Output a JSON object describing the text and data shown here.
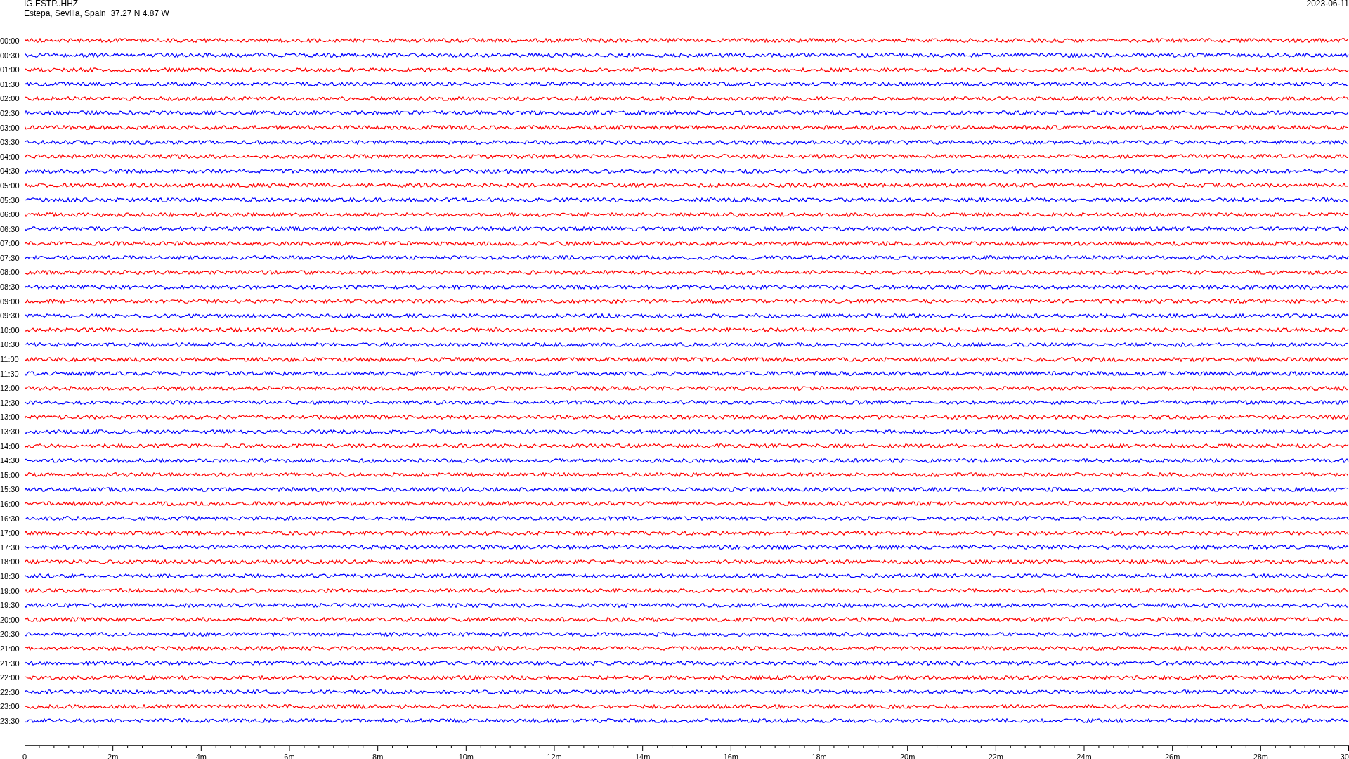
{
  "header": {
    "station": "IG.ESTP..HHZ",
    "location": "Estepa, Sevilla, Spain  37.27 N 4.87 W",
    "date": "2023-06-11"
  },
  "traces": [
    {
      "label": "00:00",
      "color": "#ff0000"
    },
    {
      "label": "00:30",
      "color": "#0000ff"
    },
    {
      "label": "01:00",
      "color": "#ff0000"
    },
    {
      "label": "01:30",
      "color": "#0000ff"
    },
    {
      "label": "02:00",
      "color": "#ff0000"
    },
    {
      "label": "02:30",
      "color": "#0000ff"
    },
    {
      "label": "03:00",
      "color": "#ff0000"
    },
    {
      "label": "03:30",
      "color": "#0000ff"
    },
    {
      "label": "04:00",
      "color": "#ff0000"
    },
    {
      "label": "04:30",
      "color": "#0000ff"
    },
    {
      "label": "05:00",
      "color": "#ff0000"
    },
    {
      "label": "05:30",
      "color": "#0000ff"
    },
    {
      "label": "06:00",
      "color": "#ff0000"
    },
    {
      "label": "06:30",
      "color": "#0000ff"
    },
    {
      "label": "07:00",
      "color": "#ff0000"
    },
    {
      "label": "07:30",
      "color": "#0000ff"
    },
    {
      "label": "08:00",
      "color": "#ff0000"
    },
    {
      "label": "08:30",
      "color": "#0000ff"
    },
    {
      "label": "09:00",
      "color": "#ff0000"
    },
    {
      "label": "09:30",
      "color": "#0000ff"
    },
    {
      "label": "10:00",
      "color": "#ff0000"
    },
    {
      "label": "10:30",
      "color": "#0000ff"
    },
    {
      "label": "11:00",
      "color": "#ff0000"
    },
    {
      "label": "11:30",
      "color": "#0000ff"
    },
    {
      "label": "12:00",
      "color": "#ff0000"
    },
    {
      "label": "12:30",
      "color": "#0000ff"
    },
    {
      "label": "13:00",
      "color": "#ff0000"
    },
    {
      "label": "13:30",
      "color": "#0000ff"
    },
    {
      "label": "14:00",
      "color": "#ff0000"
    },
    {
      "label": "14:30",
      "color": "#0000ff"
    },
    {
      "label": "15:00",
      "color": "#ff0000"
    },
    {
      "label": "15:30",
      "color": "#0000ff"
    },
    {
      "label": "16:00",
      "color": "#ff0000"
    },
    {
      "label": "16:30",
      "color": "#0000ff"
    },
    {
      "label": "17:00",
      "color": "#ff0000"
    },
    {
      "label": "17:30",
      "color": "#0000ff"
    },
    {
      "label": "18:00",
      "color": "#ff0000"
    },
    {
      "label": "18:30",
      "color": "#0000ff"
    },
    {
      "label": "19:00",
      "color": "#ff0000"
    },
    {
      "label": "19:30",
      "color": "#0000ff"
    },
    {
      "label": "20:00",
      "color": "#ff0000"
    },
    {
      "label": "20:30",
      "color": "#0000ff"
    },
    {
      "label": "21:00",
      "color": "#ff0000"
    },
    {
      "label": "21:30",
      "color": "#0000ff"
    },
    {
      "label": "22:00",
      "color": "#ff0000"
    },
    {
      "label": "22:30",
      "color": "#0000ff"
    },
    {
      "label": "23:00",
      "color": "#ff0000"
    },
    {
      "label": "23:30",
      "color": "#0000ff"
    }
  ],
  "x_axis": {
    "tick_labels": [
      "0",
      "2m",
      "4m",
      "6m",
      "8m",
      "10m",
      "12m",
      "14m",
      "16m",
      "18m",
      "20m",
      "22m",
      "24m",
      "26m",
      "28m",
      "30"
    ]
  }
}
